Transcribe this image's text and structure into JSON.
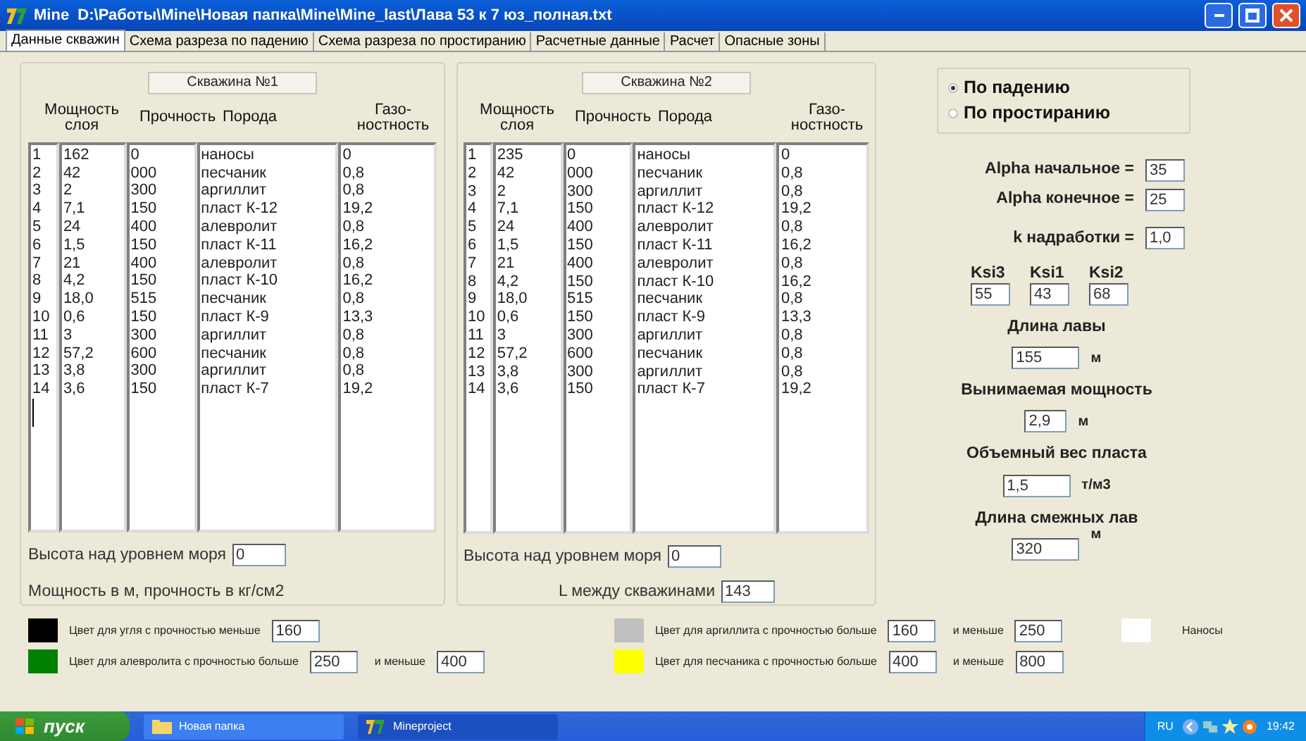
{
  "window": {
    "title": "Mine  D:\\Работы\\Mine\\Новая папка\\Mine\\Mine_last\\Лава 53 к 7 юз_полная.txt"
  },
  "tabs": [
    {
      "label": "Данные скважин",
      "selected": true
    },
    {
      "label": "Схема разреза по падению",
      "selected": false
    },
    {
      "label": "Схема разреза по простиранию",
      "selected": false
    },
    {
      "label": "Расчетные данные",
      "selected": false
    },
    {
      "label": "Расчет",
      "selected": false
    },
    {
      "label": "Опасные зоны",
      "selected": false
    }
  ],
  "wells": [
    {
      "button": "Скважина №1",
      "headers": [
        [
          "Мощность",
          "слоя"
        ],
        [
          "Прочность"
        ],
        [
          "Порода"
        ],
        [
          "Газо-",
          "ностность"
        ]
      ],
      "rows": [
        {
          "n": "1",
          "thickness": "162",
          "strength": "0",
          "rock": "наносы",
          "gas": "0"
        },
        {
          "n": "2",
          "thickness": "42",
          "strength": "000",
          "rock": "песчаник",
          "gas": "0,8"
        },
        {
          "n": "3",
          "thickness": "2",
          "strength": "300",
          "rock": "аргиллит",
          "gas": "0,8"
        },
        {
          "n": "4",
          "thickness": "7,1",
          "strength": "150",
          "rock": "пласт К-12",
          "gas": "19,2"
        },
        {
          "n": "5",
          "thickness": "24",
          "strength": "400",
          "rock": "алевролит",
          "gas": "0,8"
        },
        {
          "n": "6",
          "thickness": "1,5",
          "strength": "150",
          "rock": "пласт К-11",
          "gas": "16,2"
        },
        {
          "n": "7",
          "thickness": "21",
          "strength": "400",
          "rock": "алевролит",
          "gas": "0,8"
        },
        {
          "n": "8",
          "thickness": "4,2",
          "strength": "150",
          "rock": "пласт К-10",
          "gas": "16,2"
        },
        {
          "n": "9",
          "thickness": "18,0",
          "strength": "515",
          "rock": "песчаник",
          "gas": "0,8"
        },
        {
          "n": "10",
          "thickness": "0,6",
          "strength": "150",
          "rock": "пласт К-9",
          "gas": "13,3"
        },
        {
          "n": "11",
          "thickness": "3",
          "strength": "300",
          "rock": "аргиллит",
          "gas": "0,8"
        },
        {
          "n": "12",
          "thickness": "57,2",
          "strength": "600",
          "rock": "песчаник",
          "gas": "0,8"
        },
        {
          "n": "13",
          "thickness": "3,8",
          "strength": "300",
          "rock": "аргиллит",
          "gas": "0,8"
        },
        {
          "n": "14",
          "thickness": "3,6",
          "strength": "150",
          "rock": "пласт К-7",
          "gas": "19,2"
        }
      ],
      "cursor": true,
      "fields": [
        {
          "label": "Высота над уровнем моря",
          "value": "0"
        }
      ],
      "note": "Мощность в м, прочность в кг/см2"
    },
    {
      "button": "Скважина №2",
      "headers": [
        [
          "Мощность",
          "слоя"
        ],
        [
          "Прочность"
        ],
        [
          "Порода"
        ],
        [
          "Газо-",
          "ностность"
        ]
      ],
      "rows": [
        {
          "n": "1",
          "thickness": "235",
          "strength": "0",
          "rock": "наносы",
          "gas": "0"
        },
        {
          "n": "2",
          "thickness": "42",
          "strength": "000",
          "rock": "песчаник",
          "gas": "0,8"
        },
        {
          "n": "3",
          "thickness": "2",
          "strength": "300",
          "rock": "аргиллит",
          "gas": "0,8"
        },
        {
          "n": "4",
          "thickness": "7,1",
          "strength": "150",
          "rock": "пласт К-12",
          "gas": "19,2"
        },
        {
          "n": "5",
          "thickness": "24",
          "strength": "400",
          "rock": "алевролит",
          "gas": "0,8"
        },
        {
          "n": "6",
          "thickness": "1,5",
          "strength": "150",
          "rock": "пласт К-11",
          "gas": "16,2"
        },
        {
          "n": "7",
          "thickness": "21",
          "strength": "400",
          "rock": "алевролит",
          "gas": "0,8"
        },
        {
          "n": "8",
          "thickness": "4,2",
          "strength": "150",
          "rock": "пласт К-10",
          "gas": "16,2"
        },
        {
          "n": "9",
          "thickness": "18,0",
          "strength": "515",
          "rock": "песчаник",
          "gas": "0,8"
        },
        {
          "n": "10",
          "thickness": "0,6",
          "strength": "150",
          "rock": "пласт К-9",
          "gas": "13,3"
        },
        {
          "n": "11",
          "thickness": "3",
          "strength": "300",
          "rock": "аргиллит",
          "gas": "0,8"
        },
        {
          "n": "12",
          "thickness": "57,2",
          "strength": "600",
          "rock": "песчаник",
          "gas": "0,8"
        },
        {
          "n": "13",
          "thickness": "3,8",
          "strength": "300",
          "rock": "аргиллит",
          "gas": "0,8"
        },
        {
          "n": "14",
          "thickness": "3,6",
          "strength": "150",
          "rock": "пласт К-7",
          "gas": "19,2"
        }
      ],
      "cursor": false,
      "fields": [
        {
          "label": "Высота над уровнем моря",
          "value": "0"
        },
        {
          "label": "L между скважинами",
          "value": "143"
        }
      ]
    }
  ],
  "direction": [
    {
      "label": "По падению",
      "selected": true
    },
    {
      "label": "По простиранию",
      "selected": false
    }
  ],
  "angles": [
    {
      "label": "Alpha начальное =",
      "value": "35"
    },
    {
      "label": "Alpha конечное =",
      "value": "25"
    },
    {
      "label": "k надработки =",
      "value": "1,0"
    }
  ],
  "ksi": [
    {
      "label": "Ksi3",
      "value": "55"
    },
    {
      "label": "Ksi1",
      "value": "43"
    },
    {
      "label": "Ksi2",
      "value": "68"
    }
  ],
  "params": [
    {
      "label": "Длина лавы",
      "value": "155",
      "unit": "м"
    },
    {
      "label": "Вынимаемая мощность",
      "value": "2,9",
      "unit": "м"
    },
    {
      "label": "Объемный вес пласта",
      "value": "1,5",
      "unit": "т/м3"
    },
    {
      "label": "Длина смежных лав",
      "value": "320",
      "unit": "м"
    }
  ],
  "legend": [
    [
      {
        "color": "#000000",
        "label": "Цвет для угля с прочностью меньше",
        "value": "160"
      },
      {
        "color": "#008000",
        "label": "Цвет для алевролита с прочностью больше",
        "value": "250",
        "and_label": "и меньше",
        "and_value": "400"
      }
    ],
    [
      {
        "color": "#c0c0c0",
        "label": "Цвет для аргиллита с прочностью больше",
        "value": "160",
        "and_label": "и меньше",
        "and_value": "250"
      },
      {
        "color": "#ffff00",
        "label": "Цвет для песчаника с прочностью больше",
        "value": "400",
        "and_label": "и меньше",
        "and_value": "800"
      }
    ],
    [
      {
        "color": "#ffffff",
        "label": "Наносы"
      }
    ]
  ],
  "taskbar": {
    "start": "пуск",
    "tasks": [
      {
        "label": "Новая папка",
        "kind": "folder"
      },
      {
        "label": "Mineproject",
        "kind": "app"
      }
    ],
    "language": "RU",
    "time": "19:42"
  }
}
